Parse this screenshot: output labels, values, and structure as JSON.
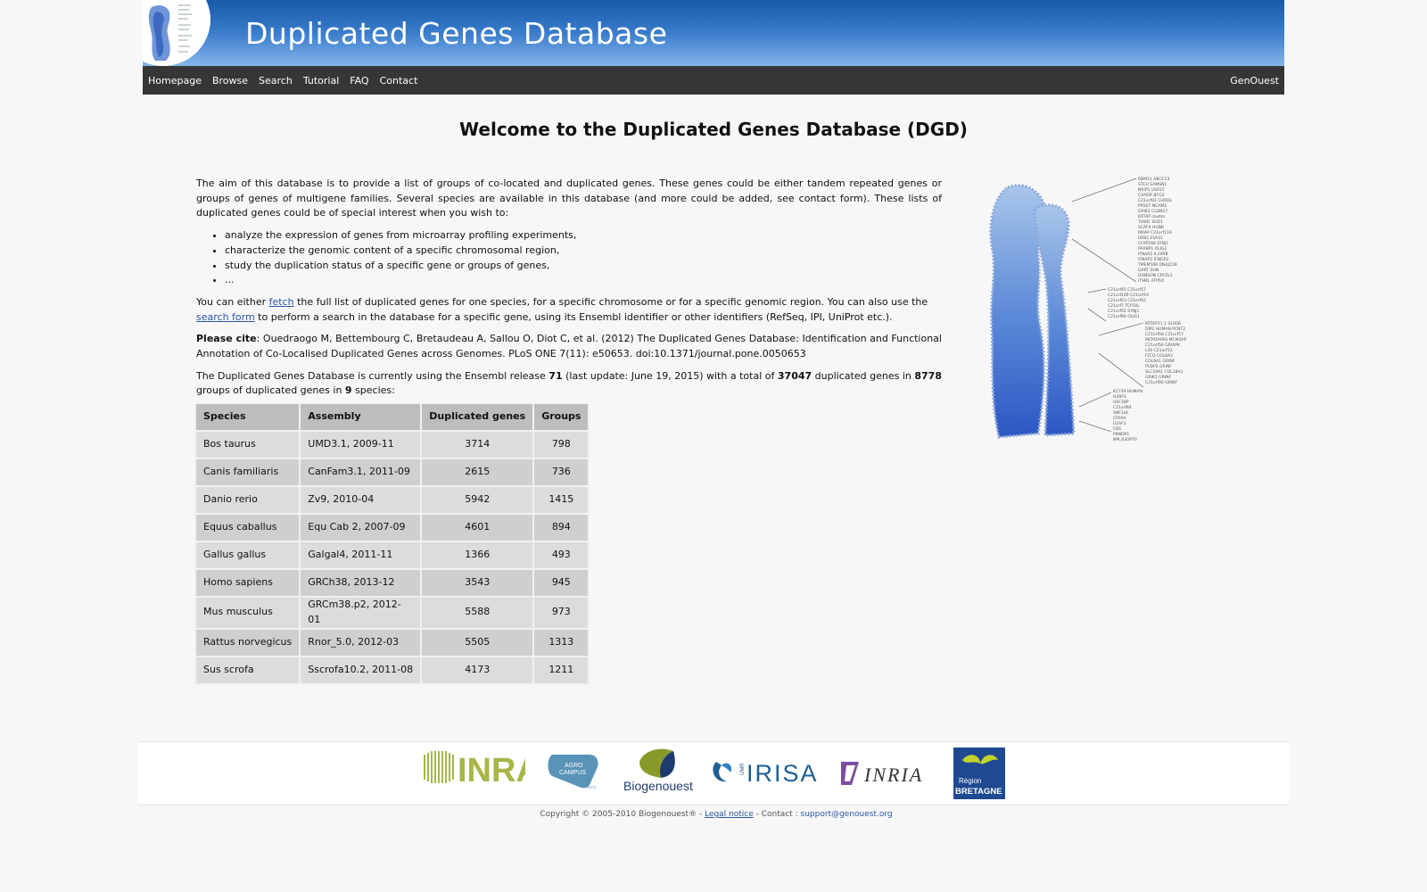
{
  "header": {
    "title": "Duplicated Genes Database"
  },
  "menu": {
    "items": [
      "Homepage",
      "Browse",
      "Search",
      "Tutorial",
      "FAQ",
      "Contact"
    ],
    "right": "GenOuest"
  },
  "page": {
    "heading": "Welcome to the Duplicated Genes Database (DGD)",
    "intro": "The aim of this database is to provide a list of groups of co-located and duplicated genes. These genes could be either tandem repeated genes or groups of genes of multigene families. Several species are available in this database (and more could be added, see contact form). These lists of duplicated genes could be of special interest when you wish to:",
    "bullets": [
      "analyze the expression of genes from microarray profiling experiments,",
      "characterize the genomic content of a specific chromosomal region,",
      "study the duplication status of a specific gene or groups of genes,",
      "..."
    ],
    "fetch_pre": "You can either ",
    "fetch_link": "fetch",
    "fetch_mid": " the full list of duplicated genes for one species, for a specific chromosome or for a specific genomic region. You can also use the ",
    "search_link": "search form",
    "fetch_post": " to perform a search in the database for a specific gene, using its Ensembl identifier or other identifiers (RefSeq, IPI, UniProt etc.).",
    "cite_label": "Please cite",
    "cite_text": ": Ouedraogo M, Bettembourg C, Bretaudeau A, Sallou O, Diot C, et al. (2012) The Duplicated Genes Database: Identification and Functional Annotation of Co-Localised Duplicated Genes across Genomes. PLoS ONE 7(11): e50653. doi:10.1371/journal.pone.0050653",
    "stats_1": "The Duplicated Genes Database is currently using the Ensembl release ",
    "release": "71",
    "stats_2": " (last update: June 19, 2015) with a total of ",
    "total_genes": "37047",
    "stats_3": " duplicated genes in ",
    "total_groups": "8778",
    "stats_4": " groups of duplicated genes in ",
    "species_count": "9",
    "stats_5": " species:"
  },
  "table": {
    "headers": [
      "Species",
      "Assembly",
      "Duplicated genes",
      "Groups"
    ],
    "rows": [
      [
        "Bos taurus",
        "UMD3.1, 2009-11",
        "3714",
        "798"
      ],
      [
        "Canis familiaris",
        "CanFam3.1, 2011-09",
        "2615",
        "736"
      ],
      [
        "Danio rerio",
        "Zv9, 2010-04",
        "5942",
        "1415"
      ],
      [
        "Equus caballus",
        "Equ Cab 2, 2007-09",
        "4601",
        "894"
      ],
      [
        "Gallus gallus",
        "Galgal4, 2011-11",
        "1366",
        "493"
      ],
      [
        "Homo sapiens",
        "GRCh38, 2013-12",
        "3543",
        "945"
      ],
      [
        "Mus musculus",
        "GRCm38.p2, 2012-01",
        "5588",
        "973"
      ],
      [
        "Rattus norvegicus",
        "Rnor_5.0, 2012-03",
        "5505",
        "1313"
      ],
      [
        "Sus scrofa",
        "Sscrofa10.2, 2011-08",
        "4173",
        "1211"
      ]
    ]
  },
  "partners": {
    "inra": "INRA",
    "agro1": "AGRO",
    "agro2": "CAMPUS",
    "agro3": "OUEST",
    "biogenouest": "Biogenouest",
    "irisa_umr": "UMR",
    "irisa": "IRISA",
    "inria": "INRIA",
    "region1": "Région",
    "region2": "BRETAGNE"
  },
  "footer": {
    "copyright": "Copyright © 2005-2010 Biogenouest® - ",
    "legal": "Legal notice",
    "contact": " - Contact : ",
    "email": "support@genouest.org"
  }
}
